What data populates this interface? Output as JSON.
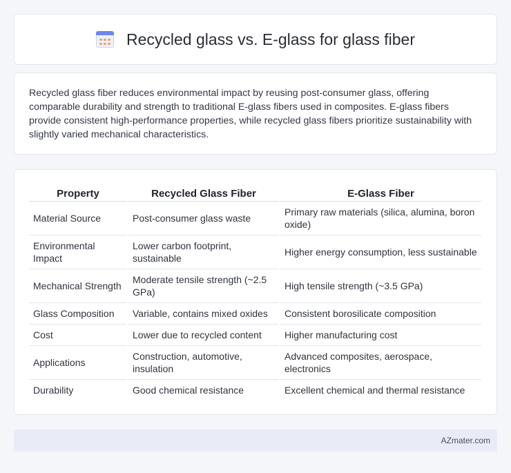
{
  "header": {
    "title": "Recycled glass vs. E-glass for glass fiber",
    "icon": "calendar-icon"
  },
  "intro": {
    "text": "Recycled glass fiber reduces environmental impact by reusing post-consumer glass, offering comparable durability and strength to traditional E-glass fibers used in composites. E-glass fibers provide consistent high-performance properties, while recycled glass fibers prioritize sustainability with slightly varied mechanical characteristics."
  },
  "table": {
    "headers": [
      "Property",
      "Recycled Glass Fiber",
      "E-Glass Fiber"
    ],
    "rows": [
      [
        "Material Source",
        "Post-consumer glass waste",
        "Primary raw materials (silica, alumina, boron oxide)"
      ],
      [
        "Environmental Impact",
        "Lower carbon footprint, sustainable",
        "Higher energy consumption, less sustainable"
      ],
      [
        "Mechanical Strength",
        "Moderate tensile strength (~2.5 GPa)",
        "High tensile strength (~3.5 GPa)"
      ],
      [
        "Glass Composition",
        "Variable, contains mixed oxides",
        "Consistent borosilicate composition"
      ],
      [
        "Cost",
        "Lower due to recycled content",
        "Higher manufacturing cost"
      ],
      [
        "Applications",
        "Construction, automotive, insulation",
        "Advanced composites, aerospace, electronics"
      ],
      [
        "Durability",
        "Good chemical resistance",
        "Excellent chemical and thermal resistance"
      ]
    ]
  },
  "footer": {
    "brand": "AZmater.com"
  }
}
